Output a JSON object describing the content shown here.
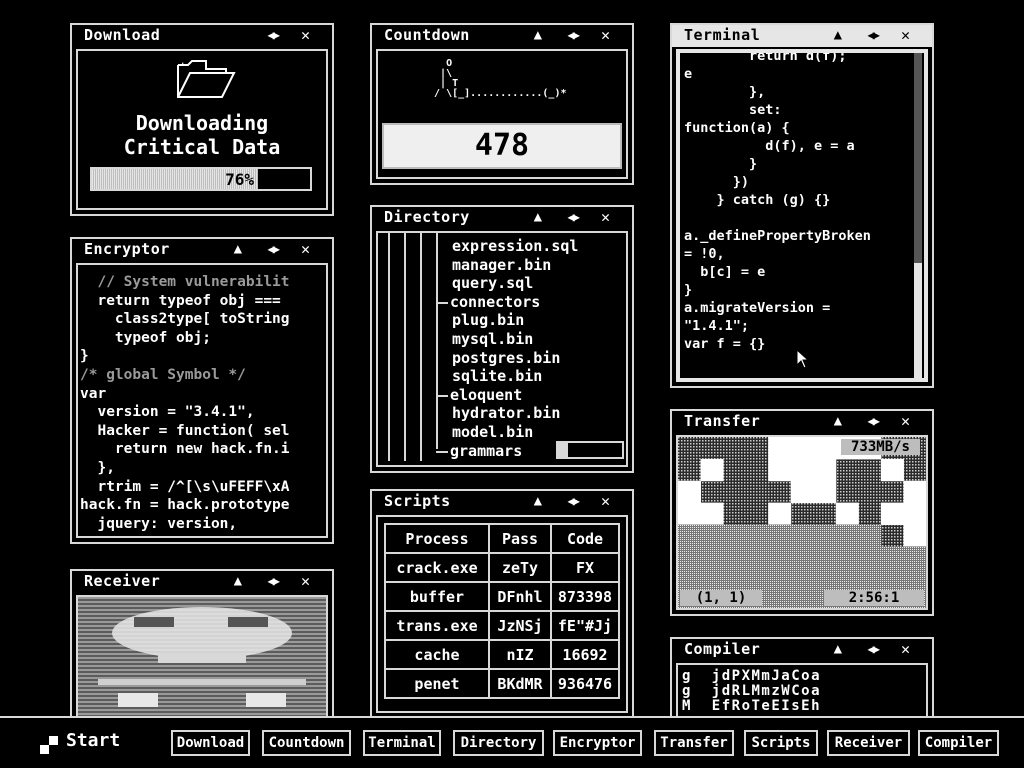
{
  "download": {
    "title": "Download",
    "heading_line1": "Downloading",
    "heading_line2": "Critical Data",
    "progress_label": "76%",
    "progress": 0.76
  },
  "countdown": {
    "title": "Countdown",
    "value": "478"
  },
  "terminal": {
    "title": "Terminal",
    "lines": [
      "        return d(f);",
      "e",
      "        },",
      "        set:",
      "function(a) {",
      "          d(f), e = a",
      "        }",
      "      })",
      "    } catch (g) {}",
      "",
      "a._definePropertyBroken",
      "= !0,",
      "  b[c] = e",
      "}",
      "a.migrateVersion =",
      "\"1.4.1\";",
      "var f = {}"
    ]
  },
  "encryptor": {
    "title": "Encryptor",
    "lines": [
      {
        "t": "  // System vulnerabilit",
        "dim": true
      },
      {
        "t": "  return typeof obj ===",
        "dim": false
      },
      {
        "t": "    class2type[ toString",
        "dim": false
      },
      {
        "t": "    typeof obj;",
        "dim": false
      },
      {
        "t": "}",
        "dim": false
      },
      {
        "t": "/* global Symbol */",
        "dim": true
      },
      {
        "t": "var",
        "dim": false
      },
      {
        "t": "  version = \"3.4.1\",",
        "dim": false
      },
      {
        "t": "  Hacker = function( sel",
        "dim": false
      },
      {
        "t": "    return new hack.fn.i",
        "dim": false
      },
      {
        "t": "  },",
        "dim": false
      },
      {
        "t": "  rtrim = /^[\\s\\uFEFF\\xA",
        "dim": false
      },
      {
        "t": "hack.fn = hack.prototype",
        "dim": false
      },
      {
        "t": "  jquery: version,",
        "dim": false
      }
    ]
  },
  "directory": {
    "title": "Directory",
    "items": [
      {
        "t": "expression.sql",
        "indent": 1
      },
      {
        "t": "manager.bin",
        "indent": 1
      },
      {
        "t": "query.sql",
        "indent": 1
      },
      {
        "t": "connectors",
        "indent": 0
      },
      {
        "t": "plug.bin",
        "indent": 1
      },
      {
        "t": "mysql.bin",
        "indent": 1
      },
      {
        "t": "postgres.bin",
        "indent": 1
      },
      {
        "t": "sqlite.bin",
        "indent": 1
      },
      {
        "t": "eloquent",
        "indent": 0
      },
      {
        "t": "hydrator.bin",
        "indent": 1
      },
      {
        "t": "model.bin",
        "indent": 1
      },
      {
        "t": "grammars",
        "indent": 0
      }
    ]
  },
  "scripts": {
    "title": "Scripts",
    "headers": [
      "Process",
      "Pass",
      "Code"
    ],
    "rows": [
      [
        "crack.exe",
        "zeTy",
        "FX"
      ],
      [
        "buffer",
        "DFnhl",
        "873398"
      ],
      [
        "trans.exe",
        "JzNSj",
        "fE\"#Jj"
      ],
      [
        "cache",
        "nIZ",
        "16692"
      ],
      [
        "penet",
        "BKdMR",
        "936476"
      ]
    ]
  },
  "transfer": {
    "title": "Transfer",
    "speed": "733MB/s",
    "coords": "(1, 1)",
    "time": "2:56:1"
  },
  "receiver": {
    "title": "Receiver"
  },
  "compiler": {
    "title": "Compiler",
    "rows": [
      "g  jdPXMmJaCoa",
      "g  jdRLMmzWCoa",
      "M  EfRoTeEIsEh"
    ]
  },
  "taskbar": {
    "start": "Start",
    "items": [
      "Download",
      "Countdown",
      "Terminal",
      "Directory",
      "Encryptor",
      "Transfer",
      "Scripts",
      "Receiver",
      "Compiler"
    ]
  },
  "icons": {
    "close": "close-icon",
    "resize": "resize-arrows-icon",
    "minimize": "caret-up-icon"
  }
}
